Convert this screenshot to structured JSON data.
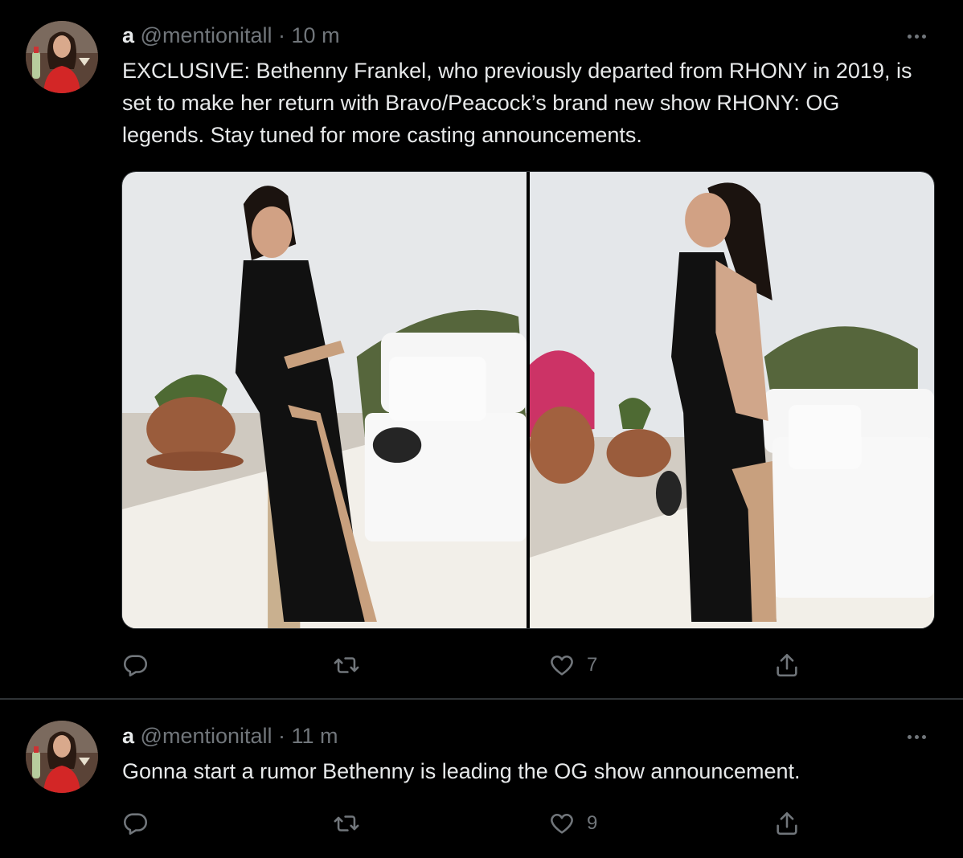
{
  "tweets": [
    {
      "display_name": "a",
      "handle": "@mentionitall",
      "time": "10 m",
      "text": "EXCLUSIVE: Bethenny Frankel, who previously departed from RHONY in 2019, is set to make her return with Bravo/Peacock’s brand new show RHONY: OG legends. Stay tuned for more casting announcements.",
      "like_count": "7",
      "icons": [
        "reply-icon",
        "retweet-icon",
        "like-icon",
        "share-icon",
        "more-icon"
      ]
    },
    {
      "display_name": "a",
      "handle": "@mentionitall",
      "time": "11 m",
      "text": "Gonna start a rumor Bethenny is leading the OG show announcement.",
      "like_count": "9",
      "icons": [
        "reply-icon",
        "retweet-icon",
        "like-icon",
        "share-icon",
        "more-icon"
      ]
    }
  ],
  "separator": " · ",
  "colors": {
    "background": "#000000",
    "text": "#e7e9ea",
    "secondary": "#71767b",
    "border": "#2f3336"
  }
}
